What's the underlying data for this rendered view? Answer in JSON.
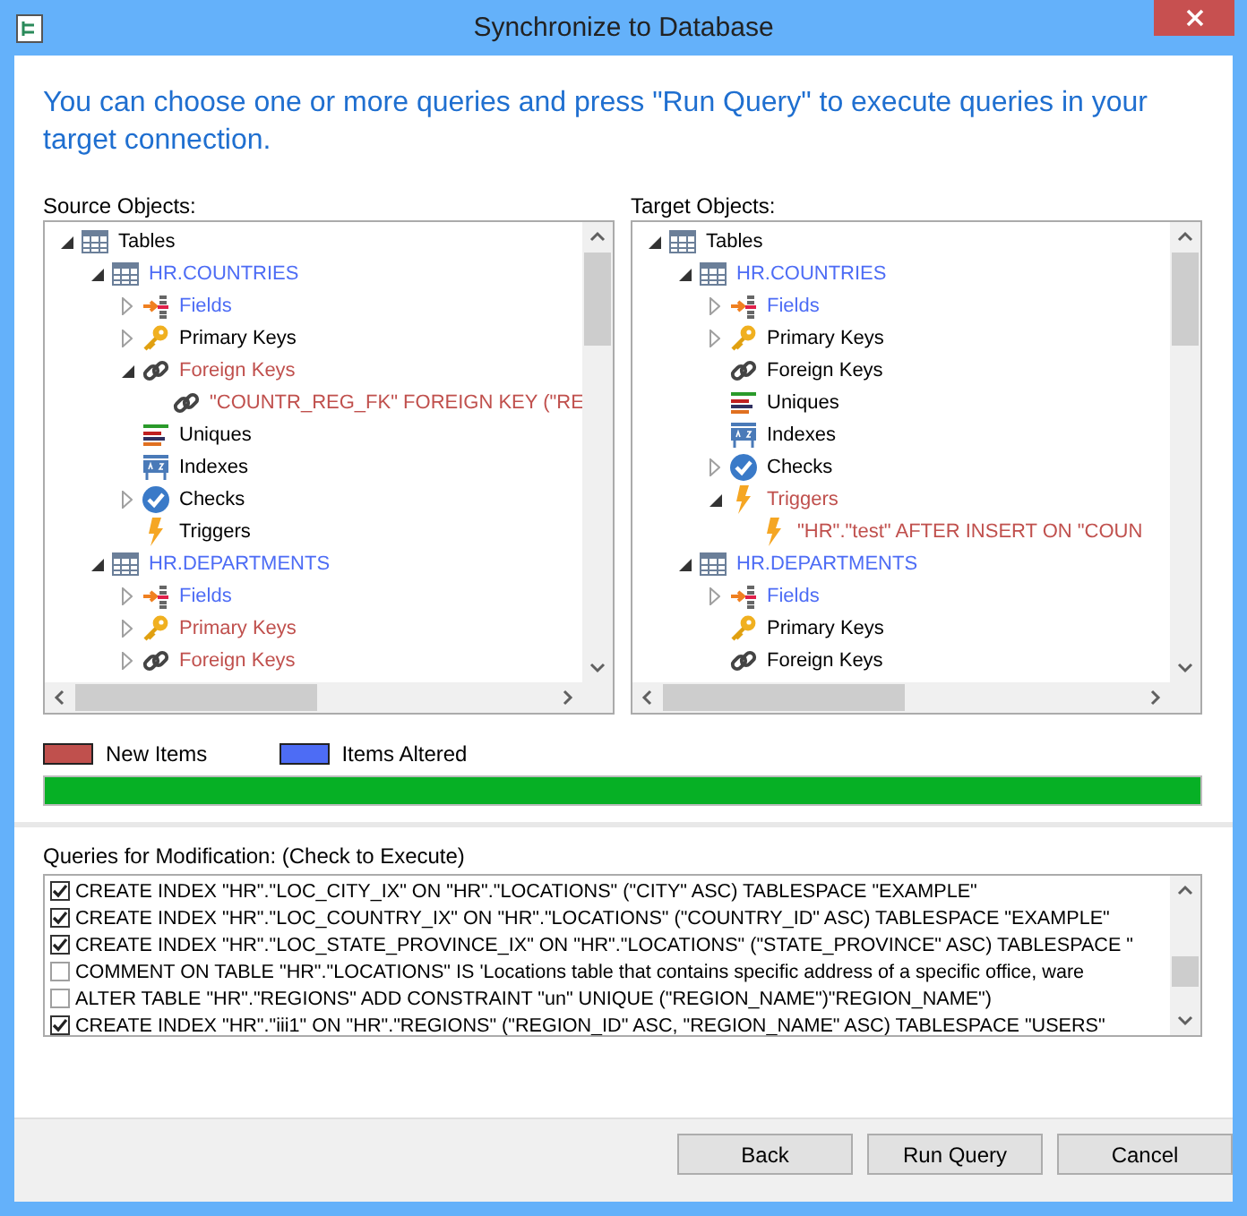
{
  "window": {
    "title": "Synchronize to Database"
  },
  "instructions": "You can choose one or more queries and press \"Run Query\" to execute queries in your target connection.",
  "source": {
    "label": "Source Objects:",
    "tree": [
      {
        "label": "Tables",
        "kind": "table",
        "color": "#000000",
        "expanded": true,
        "children": [
          {
            "label": "HR.COUNTRIES",
            "kind": "table",
            "color": "#4d6cf5",
            "expanded": true,
            "children": [
              {
                "label": "Fields",
                "kind": "fields",
                "color": "#4d6cf5",
                "expanded": false
              },
              {
                "label": "Primary Keys",
                "kind": "key",
                "color": "#000000",
                "expanded": false
              },
              {
                "label": "Foreign Keys",
                "kind": "link",
                "color": "#c0504d",
                "expanded": true,
                "children": [
                  {
                    "label": "\"COUNTR_REG_FK\" FOREIGN KEY (\"RE",
                    "kind": "link",
                    "color": "#c0504d"
                  }
                ]
              },
              {
                "label": "Uniques",
                "kind": "uniques",
                "color": "#000000"
              },
              {
                "label": "Indexes",
                "kind": "indexes",
                "color": "#000000"
              },
              {
                "label": "Checks",
                "kind": "check",
                "color": "#000000",
                "expanded": false
              },
              {
                "label": "Triggers",
                "kind": "trigger",
                "color": "#000000"
              }
            ]
          },
          {
            "label": "HR.DEPARTMENTS",
            "kind": "table",
            "color": "#4d6cf5",
            "expanded": true,
            "children": [
              {
                "label": "Fields",
                "kind": "fields",
                "color": "#4d6cf5",
                "expanded": false
              },
              {
                "label": "Primary Keys",
                "kind": "key",
                "color": "#c0504d",
                "expanded": false
              },
              {
                "label": "Foreign Keys",
                "kind": "link",
                "color": "#c0504d",
                "expanded": false
              }
            ]
          }
        ]
      }
    ]
  },
  "target": {
    "label": "Target Objects:",
    "tree": [
      {
        "label": "Tables",
        "kind": "table",
        "color": "#000000",
        "expanded": true,
        "children": [
          {
            "label": "HR.COUNTRIES",
            "kind": "table",
            "color": "#4d6cf5",
            "expanded": true,
            "children": [
              {
                "label": "Fields",
                "kind": "fields",
                "color": "#4d6cf5",
                "expanded": false
              },
              {
                "label": "Primary Keys",
                "kind": "key",
                "color": "#000000",
                "expanded": false
              },
              {
                "label": "Foreign Keys",
                "kind": "link",
                "color": "#000000"
              },
              {
                "label": "Uniques",
                "kind": "uniques",
                "color": "#000000"
              },
              {
                "label": "Indexes",
                "kind": "indexes",
                "color": "#000000"
              },
              {
                "label": "Checks",
                "kind": "check",
                "color": "#000000",
                "expanded": false
              },
              {
                "label": "Triggers",
                "kind": "trigger",
                "color": "#c0504d",
                "expanded": true,
                "children": [
                  {
                    "label": "\"HR\".\"test\" AFTER INSERT ON \"COUN",
                    "kind": "trigger",
                    "color": "#c0504d"
                  }
                ]
              }
            ]
          },
          {
            "label": "HR.DEPARTMENTS",
            "kind": "table",
            "color": "#4d6cf5",
            "expanded": true,
            "children": [
              {
                "label": "Fields",
                "kind": "fields",
                "color": "#4d6cf5",
                "expanded": false
              },
              {
                "label": "Primary Keys",
                "kind": "key",
                "color": "#000000"
              },
              {
                "label": "Foreign Keys",
                "kind": "link",
                "color": "#000000"
              }
            ]
          }
        ]
      }
    ]
  },
  "legend": [
    {
      "label": "New Items",
      "color": "#c0504d"
    },
    {
      "label": "Items Altered",
      "color": "#4d6cf5"
    }
  ],
  "progress": {
    "level": 1
  },
  "queries": {
    "label": "Queries for Modification: (Check to Execute)",
    "rows": [
      {
        "text": "CREATE INDEX \"HR\".\"LOC_CITY_IX\" ON \"HR\".\"LOCATIONS\" (\"CITY\" ASC) TABLESPACE \"EXAMPLE\"",
        "checked": true
      },
      {
        "text": "CREATE INDEX \"HR\".\"LOC_COUNTRY_IX\" ON \"HR\".\"LOCATIONS\" (\"COUNTRY_ID\" ASC) TABLESPACE \"EXAMPLE\"",
        "checked": true
      },
      {
        "text": "CREATE INDEX \"HR\".\"LOC_STATE_PROVINCE_IX\" ON \"HR\".\"LOCATIONS\" (\"STATE_PROVINCE\" ASC) TABLESPACE \"",
        "checked": true
      },
      {
        "text": "COMMENT ON TABLE \"HR\".\"LOCATIONS\" IS 'Locations table that contains specific address of a specific office, ware",
        "checked": false
      },
      {
        "text": "ALTER TABLE \"HR\".\"REGIONS\" ADD CONSTRAINT \"un\" UNIQUE (\"REGION_NAME\")\"REGION_NAME\")",
        "checked": false
      },
      {
        "text": "CREATE INDEX \"HR\".\"iii1\" ON \"HR\".\"REGIONS\" (\"REGION_ID\" ASC, \"REGION_NAME\" ASC) TABLESPACE \"USERS\"",
        "checked": true
      }
    ]
  },
  "buttons": [
    {
      "label": "Back"
    },
    {
      "label": "Run Query"
    },
    {
      "label": "Cancel"
    }
  ]
}
